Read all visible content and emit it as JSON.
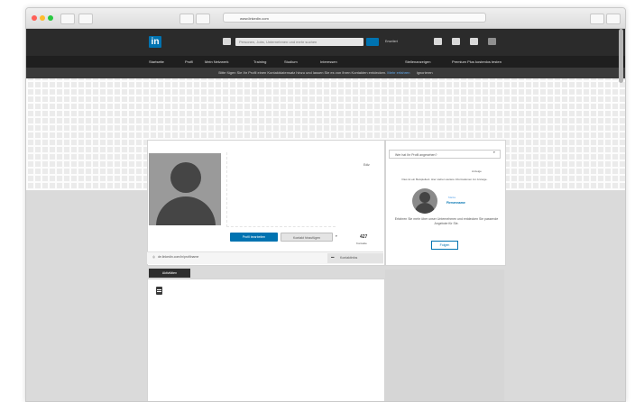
{
  "browser": {
    "url": "www.linkedin.com",
    "traffic_colors": [
      "#ff5f57",
      "#febc2e",
      "#28c840"
    ]
  },
  "nav": {
    "logo": "in",
    "search_placeholder": "Personen, Jobs, Unternehmen und mehr suchen",
    "advanced_label": "Erweitert",
    "menu": [
      "Startseite",
      "Profil",
      "Mein Netzwerk",
      "Training",
      "Studium",
      "Interessen"
    ],
    "right_menu": [
      "Stellenanzeigen",
      "Premium Plus kostenlos testen"
    ]
  },
  "banner": {
    "text": "Bitte fügen Sie Ihr Profil einen Kontaktdatensatz hinzu und lassen Sie es von Ihren Kontakten entdecken.",
    "link": "Mehr erfahren",
    "dismiss": "Ignorieren"
  },
  "profile": {
    "edit_label": "Ediz",
    "primary_button": "Profil bearbeiten",
    "secondary_button": "Kontakt hinzufügen",
    "connections_count": "427",
    "connections_label": "Kontakte",
    "profile_url": "de.linkedin.com/in/profilname",
    "contact_info": "Kontaktinfos"
  },
  "sidebar": {
    "select_label": "Wer hat Ihr Profil angesehen?",
    "ad_label": "Anzeige",
    "intro": "Dies ist ein Beispieltext. Hier stehen weitere Informationen zur Anzeige.",
    "brand_small": "Marke",
    "brand_name": "Firmenname",
    "body": "Erfahren Sie mehr über unser Unternehmen und entdecken Sie passende Angebote für Sie.",
    "follow_button": "Folgen"
  },
  "section": {
    "tab_label": "Aktivitäten"
  }
}
